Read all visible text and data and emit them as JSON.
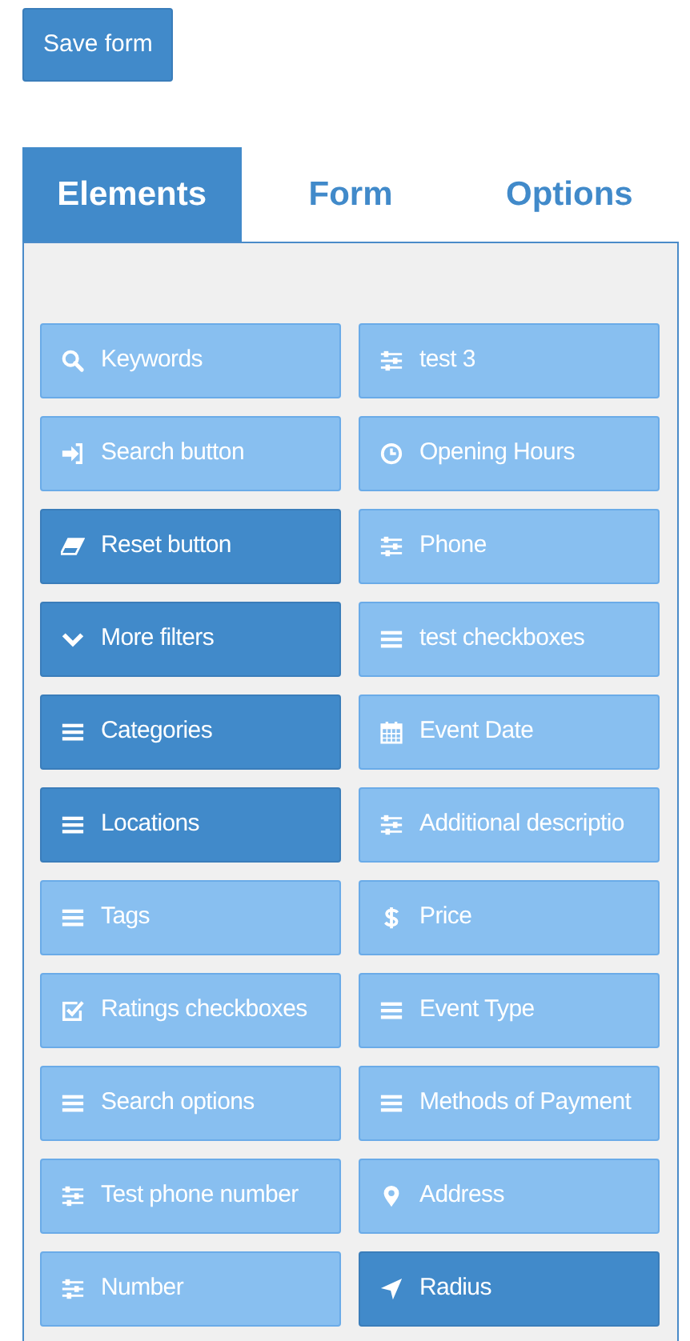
{
  "save_button": "Save form",
  "tabs": [
    {
      "label": "Elements",
      "selected": true
    },
    {
      "label": "Form",
      "selected": false
    },
    {
      "label": "Options",
      "selected": false
    }
  ],
  "elements": [
    {
      "label": "Keywords",
      "active": false
    },
    {
      "label": "test 3",
      "active": false
    },
    {
      "label": "Search button",
      "active": false
    },
    {
      "label": "Opening Hours",
      "active": false
    },
    {
      "label": "Reset button",
      "active": true
    },
    {
      "label": "Phone",
      "active": false
    },
    {
      "label": "More filters",
      "active": true
    },
    {
      "label": "test checkboxes",
      "active": false
    },
    {
      "label": "Categories",
      "active": true
    },
    {
      "label": "Event Date",
      "active": false
    },
    {
      "label": "Locations",
      "active": true
    },
    {
      "label": "Additional descriptio",
      "active": false
    },
    {
      "label": "Tags",
      "active": false
    },
    {
      "label": "Price",
      "active": false
    },
    {
      "label": "Ratings checkboxes",
      "active": false
    },
    {
      "label": "Event Type",
      "active": false
    },
    {
      "label": "Search options",
      "active": false
    },
    {
      "label": "Methods of Payment",
      "active": false
    },
    {
      "label": "Test phone number",
      "active": false
    },
    {
      "label": "Address",
      "active": false
    },
    {
      "label": "Number",
      "active": false
    },
    {
      "label": "Radius",
      "active": true
    }
  ]
}
